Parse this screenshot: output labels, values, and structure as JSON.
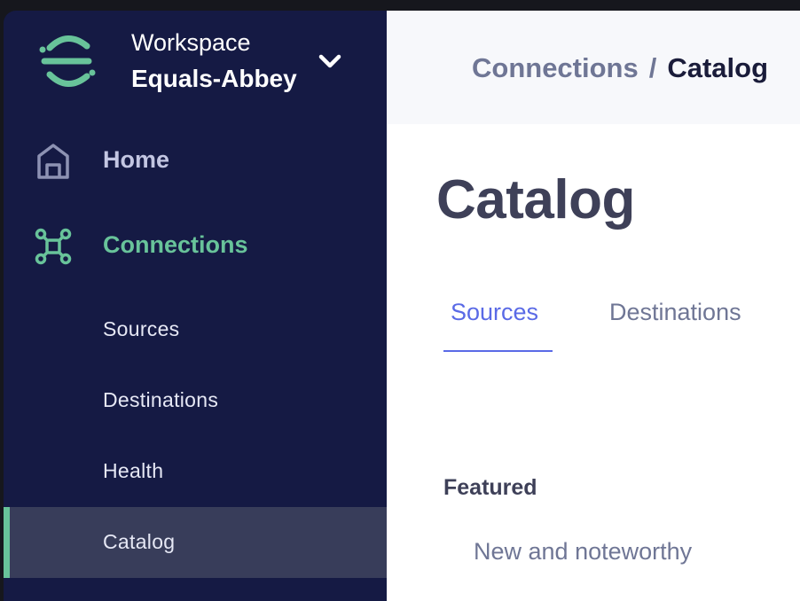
{
  "workspace": {
    "label": "Workspace",
    "name": "Equals-Abbey"
  },
  "sidebar": {
    "nav": [
      {
        "label": "Home",
        "icon": "home-icon"
      },
      {
        "label": "Connections",
        "icon": "connections-icon"
      }
    ],
    "sub_items": [
      {
        "label": "Sources"
      },
      {
        "label": "Destinations"
      },
      {
        "label": "Health"
      },
      {
        "label": "Catalog",
        "active": true
      }
    ]
  },
  "breadcrumb": {
    "parent": "Connections",
    "separator": "/",
    "current": "Catalog"
  },
  "page": {
    "title": "Catalog",
    "tabs": [
      {
        "label": "Sources",
        "active": true
      },
      {
        "label": "Destinations",
        "active": false
      }
    ],
    "featured": {
      "heading": "Featured",
      "subheading": "New and noteworthy"
    }
  },
  "colors": {
    "sidebar_bg": "#151a44",
    "accent_green": "#68c39a",
    "accent_blue": "#5a6ae6",
    "active_item_bg": "#383d5a"
  }
}
